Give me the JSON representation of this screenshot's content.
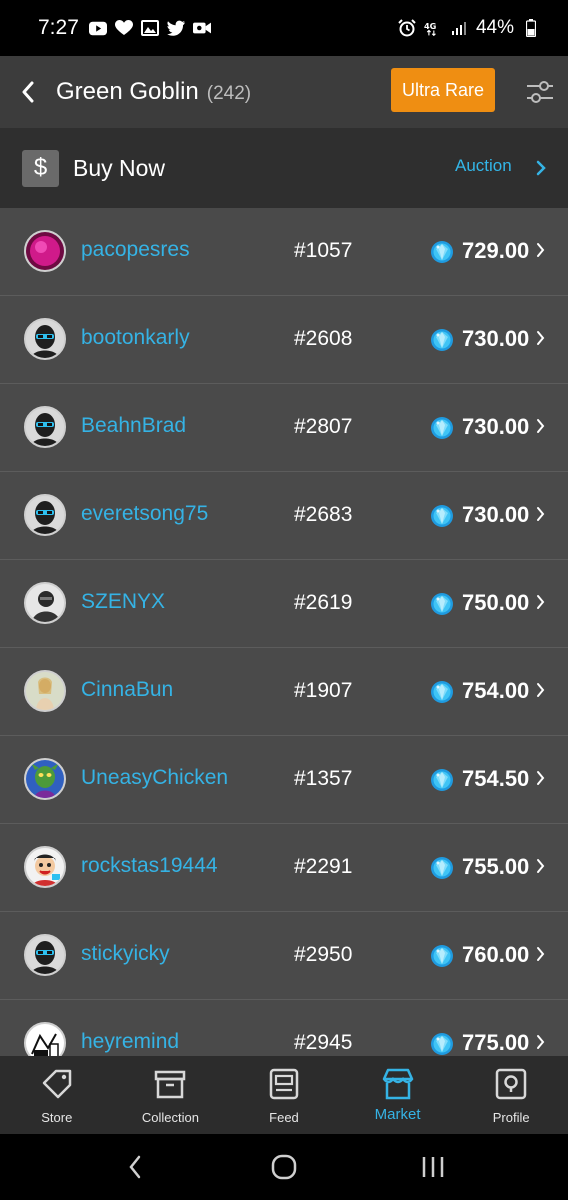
{
  "status_bar": {
    "time": "7:27",
    "battery": "44%",
    "network": "4G"
  },
  "header": {
    "title": "Green Goblin",
    "count": "(242)",
    "rarity_label": "Ultra Rare",
    "rarity_color": "#ef8e12"
  },
  "buy_bar": {
    "dollar_symbol": "$",
    "label": "Buy Now",
    "auction_label": "Auction"
  },
  "listings": [
    {
      "user": "pacopesres",
      "serial": "#1057",
      "price": "729.00",
      "avatar": "pink-orb"
    },
    {
      "user": "bootonkarly",
      "serial": "#2608",
      "price": "730.00",
      "avatar": "default-mask"
    },
    {
      "user": "BeahnBrad",
      "serial": "#2807",
      "price": "730.00",
      "avatar": "default-mask"
    },
    {
      "user": "everetsong75",
      "serial": "#2683",
      "price": "730.00",
      "avatar": "default-mask"
    },
    {
      "user": "SZENYX",
      "serial": "#2619",
      "price": "750.00",
      "avatar": "dark-figure"
    },
    {
      "user": "CinnaBun",
      "serial": "#1907",
      "price": "754.00",
      "avatar": "light-figure"
    },
    {
      "user": "UneasyChicken",
      "serial": "#1357",
      "price": "754.50",
      "avatar": "green-goblin"
    },
    {
      "user": "rockstas19444",
      "serial": "#2291",
      "price": "755.00",
      "avatar": "cartoon"
    },
    {
      "user": "stickyicky",
      "serial": "#2950",
      "price": "760.00",
      "avatar": "default-mask"
    },
    {
      "user": "heyremind",
      "serial": "#2945",
      "price": "775.00",
      "avatar": "sketch"
    }
  ],
  "bottom_nav": [
    {
      "label": "Store",
      "icon": "tag-icon",
      "active": false
    },
    {
      "label": "Collection",
      "icon": "box-icon",
      "active": false
    },
    {
      "label": "Feed",
      "icon": "feed-icon",
      "active": false
    },
    {
      "label": "Market",
      "icon": "store-icon",
      "active": true
    },
    {
      "label": "Profile",
      "icon": "profile-icon",
      "active": false
    }
  ],
  "colors": {
    "accent": "#35b3e5",
    "background": "#4a4a4a",
    "header": "#3c3c3c",
    "buy_bar": "#2f2f2f"
  }
}
